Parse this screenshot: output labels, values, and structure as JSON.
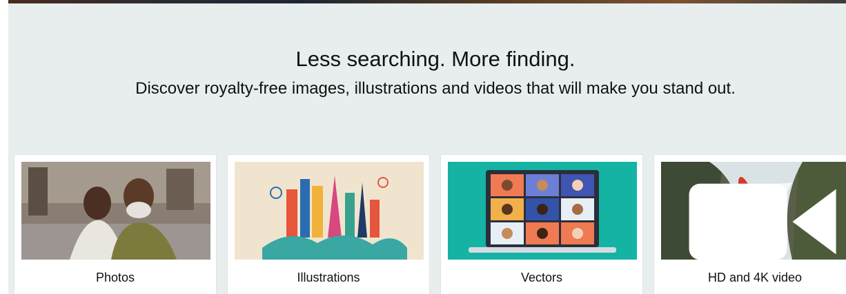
{
  "hero": {
    "headline": "Less searching. More finding.",
    "subheadline": "Discover royalty-free images, illustrations and videos that will make you stand out."
  },
  "categories": [
    {
      "label": "Photos",
      "icon": "photo-thumbnail"
    },
    {
      "label": "Illustrations",
      "icon": "illustration-thumbnail"
    },
    {
      "label": "Vectors",
      "icon": "vector-thumbnail"
    },
    {
      "label": "HD and 4K video",
      "icon": "video-camera-icon"
    }
  ],
  "colors": {
    "section_background": "#e8eded",
    "card_background": "#ffffff",
    "text": "#111111",
    "vector_teal": "#14b3a3"
  }
}
